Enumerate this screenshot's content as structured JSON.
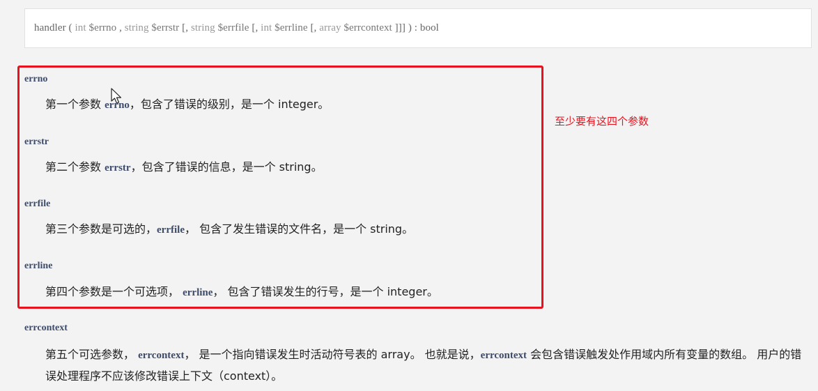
{
  "signature": {
    "handler": "handler",
    "open": " ( ",
    "p1_type": "int",
    "p1_name": " $errno",
    "sep1": " , ",
    "p2_type": "string",
    "p2_name": " $errstr",
    "sep2": " [, ",
    "p3_type": "string",
    "p3_name": " $errfile",
    "sep3": " [, ",
    "p4_type": "int",
    "p4_name": " $errline",
    "sep4": " [, ",
    "p5_type": "array",
    "p5_name": " $errcontext",
    "close": " ]]] ) : bool"
  },
  "params": [
    {
      "term": "errno",
      "desc_before": "第一个参数 ",
      "code": "errno",
      "desc_after": "，包含了错误的级别，是一个 integer。"
    },
    {
      "term": "errstr",
      "desc_before": "第二个参数 ",
      "code": "errstr",
      "desc_after": "，包含了错误的信息，是一个 string。"
    },
    {
      "term": "errfile",
      "desc_before": "第三个参数是可选的，",
      "code": "errfile",
      "desc_after": "， 包含了发生错误的文件名，是一个 string。"
    },
    {
      "term": "errline",
      "desc_before": "第四个参数是一个可选项， ",
      "code": "errline",
      "desc_after": "， 包含了错误发生的行号，是一个 integer。"
    },
    {
      "term": "errcontext",
      "desc_before": "第五个可选参数， ",
      "code": "errcontext",
      "desc_mid": "， 是一个指向错误发生时活动符号表的 array。 也就是说，",
      "code2": "errcontext",
      "desc_after": " 会包含错误触发处作用域内所有变量的数组。 用户的错误处理程序不应该修改错误上下文（context）。"
    }
  ],
  "annotation": "至少要有这四个参数",
  "colors": {
    "highlight_border": "#e8111e",
    "annotation_text": "#e8111e",
    "code_text": "#3d4b6b"
  },
  "icons": {
    "cursor": "mouse-pointer-icon"
  }
}
